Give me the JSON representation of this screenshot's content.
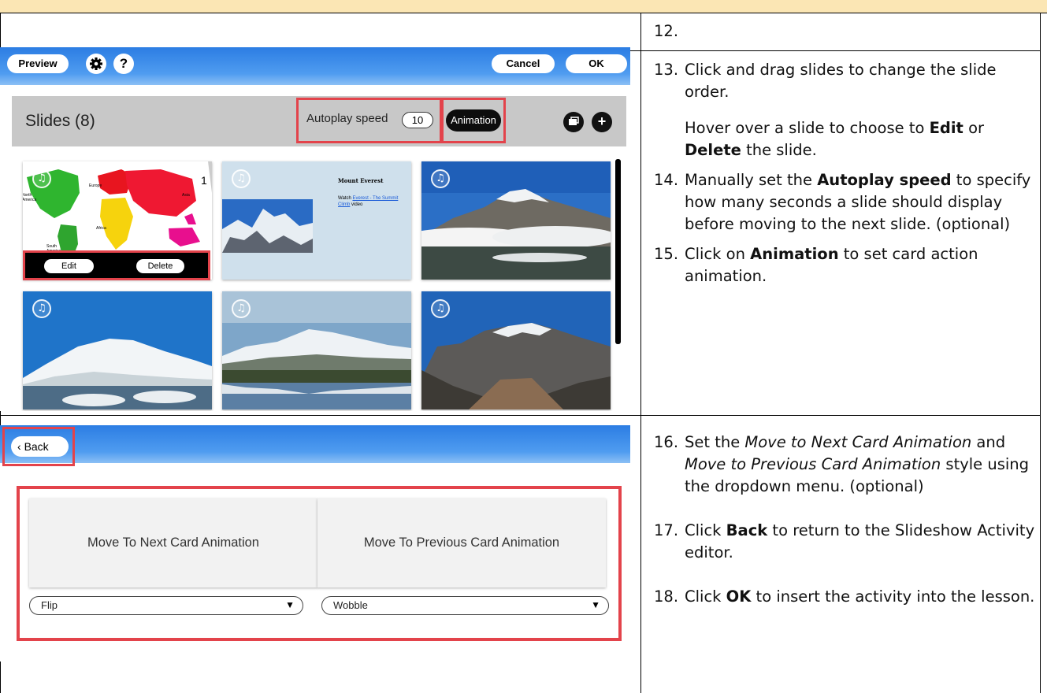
{
  "steps": {
    "s12": {
      "num": "12."
    },
    "s13": {
      "num": "13.",
      "line1": "Click and drag slides to change the slide order.",
      "p2_a": "Hover over a slide to choose to ",
      "p2_edit": "Edit",
      "p2_or": " or ",
      "p2_delete": "Delete",
      "p2_end": " the slide."
    },
    "s14": {
      "num": "14.",
      "a": "Manually set the ",
      "bold": "Autoplay speed",
      "b": " to specify how many seconds a slide should display before moving to the next slide. (optional)"
    },
    "s15": {
      "num": "15.",
      "a": "Click on ",
      "bold": "Animation",
      "b": " to set card action animation."
    },
    "s16": {
      "num": "16.",
      "a": "Set the ",
      "it1": "Move to Next Card Animation",
      "b": " and ",
      "it2": "Move to Previous Card Animation",
      "c": " style using the dropdown menu. (optional)"
    },
    "s17": {
      "num": "17.",
      "a": "Click ",
      "bold": "Back",
      "b": " to return to the Slideshow Activity editor."
    },
    "s18": {
      "num": "18.",
      "a": "Click ",
      "bold": "OK",
      "b": " to insert the activity into the lesson."
    }
  },
  "editor": {
    "preview_label": "Preview",
    "settings_icon": "gear-icon",
    "help_label": "?",
    "cancel_label": "Cancel",
    "ok_label": "OK",
    "slides_title": "Slides (8)",
    "autoplay_label": "Autoplay speed",
    "autoplay_value": "10",
    "animation_label": "Animation",
    "copy_icon": "duplicate-icon",
    "add_label": "+",
    "slide1": {
      "number": "1",
      "regions": [
        "North America",
        "Europe",
        "Asia",
        "Africa",
        "South America"
      ],
      "edit_label": "Edit",
      "delete_label": "Delete"
    },
    "slide2": {
      "heading": "Mount Everest",
      "text_prefix": "Watch ",
      "link": "Everest - The Summit Climb",
      "text_suffix": " video"
    }
  },
  "animation_screen": {
    "back_label": "Back",
    "next_card_label": "Move To Next Card Animation",
    "prev_card_label": "Move To Previous Card Animation",
    "next_value": "Flip",
    "prev_value": "Wobble"
  },
  "colors": {
    "highlight": "#e3434b",
    "header_strip": "#fbe6b4",
    "app_bar": "#2c7de3"
  }
}
